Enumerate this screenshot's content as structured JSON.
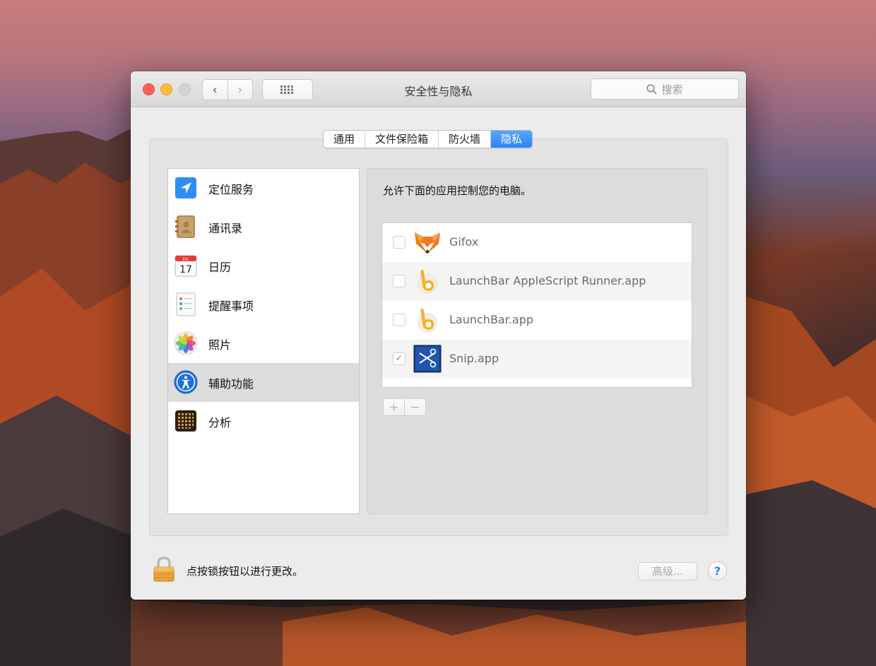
{
  "window": {
    "title": "安全性与隐私",
    "search_placeholder": "搜索"
  },
  "nav": {
    "back_label": "‹",
    "forward_label": "›"
  },
  "tabs": [
    {
      "label": "通用",
      "active": false
    },
    {
      "label": "文件保险箱",
      "active": false
    },
    {
      "label": "防火墙",
      "active": false
    },
    {
      "label": "隐私",
      "active": true
    }
  ],
  "categories": [
    {
      "label": "定位服务",
      "icon": "location-arrow-icon",
      "selected": false
    },
    {
      "label": "通讯录",
      "icon": "contacts-book-icon",
      "selected": false
    },
    {
      "label": "日历",
      "icon": "calendar-icon",
      "selected": false,
      "icon_text": "17",
      "icon_month": "JUL"
    },
    {
      "label": "提醒事项",
      "icon": "reminders-icon",
      "selected": false
    },
    {
      "label": "照片",
      "icon": "photos-icon",
      "selected": false
    },
    {
      "label": "辅助功能",
      "icon": "accessibility-icon",
      "selected": true
    },
    {
      "label": "分析",
      "icon": "analytics-grid-icon",
      "selected": false
    }
  ],
  "panel": {
    "prompt": "允许下面的应用控制您的电脑。",
    "apps": [
      {
        "name": "Gifox",
        "checked": false,
        "icon": "fox-icon"
      },
      {
        "name": "LaunchBar AppleScript Runner.app",
        "checked": false,
        "icon": "launchbar-icon"
      },
      {
        "name": "LaunchBar.app",
        "checked": false,
        "icon": "launchbar-icon"
      },
      {
        "name": "Snip.app",
        "checked": true,
        "icon": "scissors-icon"
      }
    ],
    "add_label": "+",
    "remove_label": "−"
  },
  "footer": {
    "lock_text": "点按锁按钮以进行更改。",
    "advanced_label": "高级...",
    "help_label": "?"
  },
  "colors": {
    "accent": "#2c83f5",
    "close": "#fc605c",
    "minimize": "#fdbc40"
  }
}
